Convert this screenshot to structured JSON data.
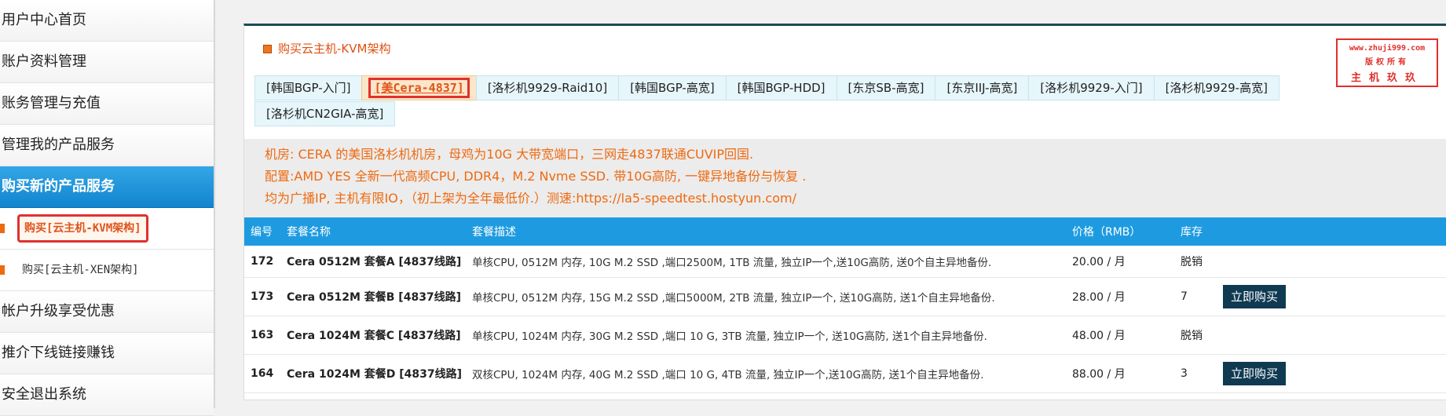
{
  "sidebar": {
    "items": [
      {
        "label": "用户中心首页"
      },
      {
        "label": "账户资料管理"
      },
      {
        "label": "账务管理与充值"
      },
      {
        "label": "管理我的产品服务"
      },
      {
        "label": "购买新的产品服务"
      }
    ],
    "sub_items": [
      {
        "label": "购买[云主机-KVM架构]"
      },
      {
        "label": "购买[云主机-XEN架构]"
      }
    ],
    "bottom_items": [
      {
        "label": "帐户升级享受优惠"
      },
      {
        "label": "推介下线链接赚钱"
      },
      {
        "label": "安全退出系统"
      }
    ]
  },
  "panel": {
    "title": "购买云主机-KVM架构"
  },
  "stamp": {
    "line1": "www.zhuji999.com",
    "line2": "版权所有",
    "line3": "主机玖玖"
  },
  "tabs": [
    {
      "label": "[韩国BGP-入门]"
    },
    {
      "label": "[美Cera-4837]"
    },
    {
      "label": "[洛杉机9929-Raid10]"
    },
    {
      "label": "[韩国BGP-高宽]"
    },
    {
      "label": "[韩国BGP-HDD]"
    },
    {
      "label": "[东京SB-高宽]"
    },
    {
      "label": "[东京IIJ-高宽]"
    },
    {
      "label": "[洛杉机9929-入门]"
    },
    {
      "label": "[洛杉机9929-高宽]"
    },
    {
      "label": "[洛杉机CN2GIA-高宽]"
    }
  ],
  "description": {
    "line1": "机房: CERA 的美国洛杉机机房，母鸡为10G 大带宽端口，三网走4837联通CUVIP回国.",
    "line2": "配置:AMD YES 全新一代高频CPU, DDR4，M.2 Nvme SSD. 带10G高防, 一键异地备份与恢复 .",
    "line3": "均为广播IP, 主机有限IO，（初上架为全年最低价.）测速:https://la5-speedtest.hostyun.com/"
  },
  "table": {
    "headers": {
      "id": "编号",
      "name": "套餐名称",
      "desc": "套餐描述",
      "price": "价格（RMB）",
      "stock": "库存"
    },
    "rows": [
      {
        "id": "172",
        "name": "Cera 0512M 套餐A [4837线路]",
        "desc": "单核CPU, 0512M 内存, 10G M.2 SSD ,端口2500M, 1TB 流量, 独立IP一个,送10G高防, 送0个自主异地备份.",
        "price": "20.00 / 月",
        "stock": "脱销",
        "button": ""
      },
      {
        "id": "173",
        "name": "Cera 0512M 套餐B [4837线路]",
        "desc": "单核CPU, 0512M 内存, 15G M.2 SSD ,端口5000M, 2TB 流量, 独立IP一个, 送10G高防, 送1个自主异地备份.",
        "price": "28.00 / 月",
        "stock": "7",
        "button": "立即购买"
      },
      {
        "id": "163",
        "name": "Cera 1024M 套餐C [4837线路]",
        "desc": "单核CPU, 1024M 内存, 30G M.2 SSD ,端口 10 G, 3TB 流量, 独立IP一个, 送10G高防, 送1个自主异地备份.",
        "price": "48.00 / 月",
        "stock": "脱销",
        "button": ""
      },
      {
        "id": "164",
        "name": "Cera 1024M 套餐D [4837线路]",
        "desc": "双核CPU, 1024M 内存, 40G M.2 SSD ,端口 10 G, 4TB 流量, 独立IP一个,送10G高防, 送1个自主异地备份.",
        "price": "88.00 / 月",
        "stock": "3",
        "button": "立即购买"
      }
    ]
  }
}
